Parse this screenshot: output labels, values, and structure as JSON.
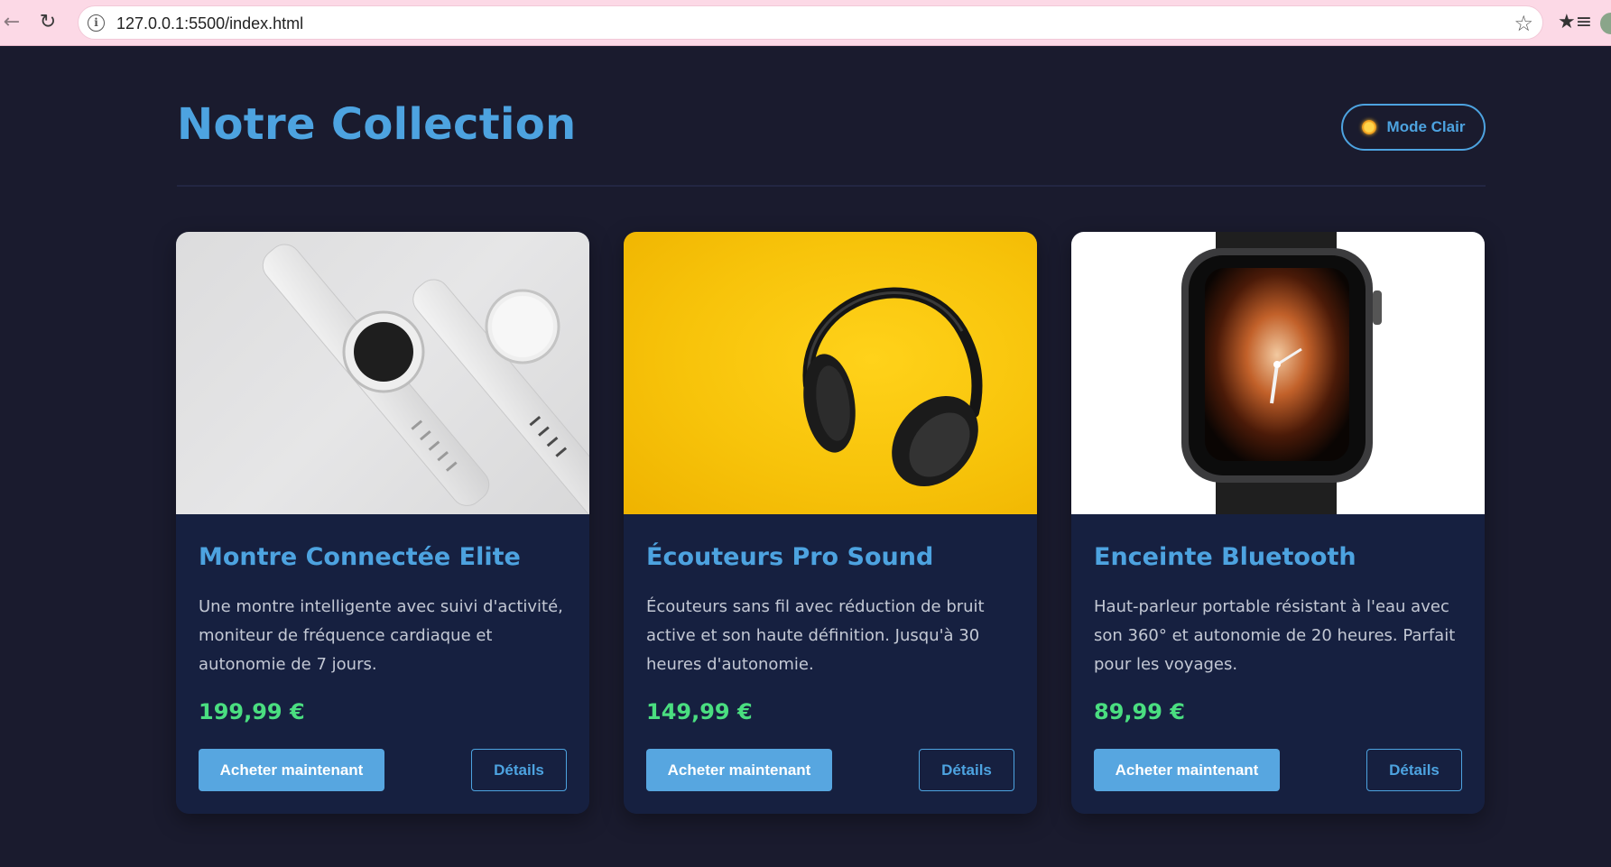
{
  "browser": {
    "url": "127.0.0.1:5500/index.html"
  },
  "page": {
    "title": "Notre Collection",
    "theme_toggle_label": "Mode Clair"
  },
  "colors": {
    "background": "#1a1b2e",
    "card_background": "#162040",
    "accent": "#4da3e0",
    "price": "#4ade80",
    "buy_button": "#57a6e0"
  },
  "products": [
    {
      "title": "Montre Connectée Elite",
      "description": "Une montre intelligente avec suivi d'activité, moniteur de fréquence cardiaque et autonomie de 7 jours.",
      "price": "199,99 €",
      "buy_label": "Acheter maintenant",
      "details_label": "Détails",
      "image": "white-smartwatches-photo"
    },
    {
      "title": "Écouteurs Pro Sound",
      "description": "Écouteurs sans fil avec réduction de bruit active et son haute définition. Jusqu'à 30 heures d'autonomie.",
      "price": "149,99 €",
      "buy_label": "Acheter maintenant",
      "details_label": "Détails",
      "image": "black-headphones-photo"
    },
    {
      "title": "Enceinte Bluetooth",
      "description": "Haut-parleur portable résistant à l'eau avec son 360° et autonomie de 20 heures. Parfait pour les voyages.",
      "price": "89,99 €",
      "buy_label": "Acheter maintenant",
      "details_label": "Détails",
      "image": "black-smartwatch-photo"
    }
  ]
}
